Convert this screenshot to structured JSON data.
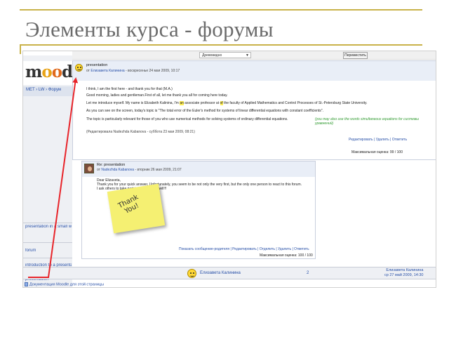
{
  "slide": {
    "title": "Элементы курса - форумы"
  },
  "moodle": {
    "logo": {
      "m": "m",
      "o1": "o",
      "o2": "o",
      "d": "d"
    },
    "breadcrumb": "MET › LW › Форум",
    "select_value": "Древовидно",
    "move_button": "Переместить",
    "side_links": [
      "presentation in a small wo",
      "forum",
      "introduction to a presenta",
      "presentation"
    ],
    "docs_link": "Документация Moodle для этой страницы"
  },
  "post": {
    "subject": "presentation",
    "meta_prefix": "от ",
    "author": "Елизавета Калинина",
    "date": " - воскресенье 24 мая 2009, 10:17",
    "line1": "I think, I am the first here  - and thank you for that  (M.A.)",
    "line2": "Good morning, ladies and gentleman.First of all, let me thank you all for coming here today.",
    "line3a": "Let me introduce myself. My name is Elizabeth Kalinina, I'm ",
    "line3_hl1": "an",
    "line3b": " associate professor at ",
    "line3_hl2": "of",
    "line3c": " the faculty of Applied Mathematics and Control Processes of St.-Petersburg State University.",
    "line4": "As you can see on the screen, today's topic is \"The total error of the Euler's method for systems of linear differential equations with constant coefficients\".",
    "line5": "The topic is particularly relevant for those of you who use numerical methods for solving systems of ordinary differential equations.",
    "line5_green": "(you may also use the words simultaneous equations for системы уравнений)",
    "edited": "(Редактировала Nadezhda Kabanova - суббота 23 мая 2009, 08:21)",
    "links": "Редактировать | Удалить | Ответить",
    "grade": "Максимальная оценка: 99 / 100",
    "grade_select": "99 / 100"
  },
  "reply": {
    "subject": "Re: presentation",
    "meta_prefix": "от ",
    "author": "Nadezhda Kabanova",
    "date": " - вторник 26 мая 2009, 21:07",
    "line1": "Dear Elizaveta,",
    "line2": "Thank you for your quick answer. Unfortunately, you seem to be not only the very first, but the only one person to react to this forum.",
    "line3": "I ask others to take part in this work as well!!!",
    "sticky": "Thank\nYou!",
    "links": "Показать сообщение-родителя | Редактировать | Отделить | Удалить | Ответить",
    "grade": "Максимальная оценка: 100 / 100"
  },
  "bottom_row": {
    "author": "Елизавета Калинина",
    "count": "2",
    "last_author": "Елизавета Калинина",
    "last_date": "ср 27 май 2009, 14:30"
  },
  "colors": {
    "accent_rule": "#c9b24a",
    "link": "#2850a8",
    "arrow": "#e8242a",
    "sticky": "#f5f072"
  }
}
